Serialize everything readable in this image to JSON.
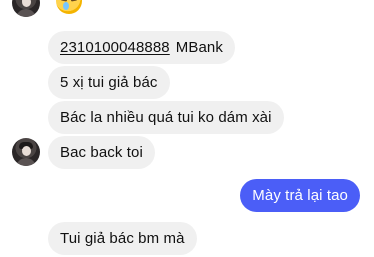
{
  "chat": {
    "top_emoji": "crying-face",
    "messages": [
      {
        "account_number": "2310100048888",
        "bank": "MBank"
      },
      {
        "text": "5 xị tui giả bác"
      },
      {
        "text": "Bác la nhiều quá tui ko dám xài"
      },
      {
        "text": "Bac back toi"
      },
      {
        "text": "Mày trả lại tao"
      },
      {
        "text": "Tui giả bác bm mà"
      }
    ]
  }
}
